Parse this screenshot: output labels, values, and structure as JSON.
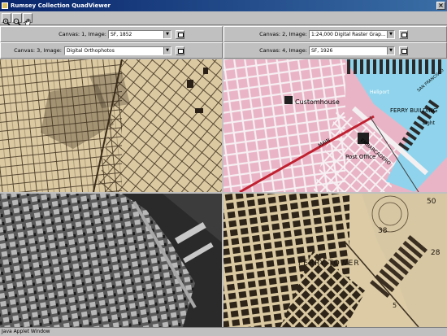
{
  "window": {
    "title": "Rumsey Collection QuadViewer",
    "close_glyph": "×"
  },
  "toolbar": {
    "tools": [
      "zoom-in-icon",
      "zoom-out-icon",
      "pan-hand-icon"
    ]
  },
  "canvases": [
    {
      "label": "Canvas: 1, Image:",
      "selected": "SF, 1852"
    },
    {
      "label": "Canvas: 2, Image:",
      "selected": "1:24,000  Digital Raster Grap..."
    },
    {
      "label": "Canvas: 3, Image:",
      "selected": "Digital Orthophotos"
    },
    {
      "label": "Canvas: 4, Image:",
      "selected": "SF, 1926"
    }
  ],
  "maps": {
    "top_right_labels": [
      "Customhouse",
      "FERRY BUILDING",
      "Light",
      "Post Office",
      "MAIN",
      "EMBARCADERO",
      "Heliport",
      "SAN FRANCISCO"
    ],
    "bottom_right_labels": [
      "FERRY TOWER",
      "50",
      "38",
      "28",
      "5"
    ]
  },
  "status": {
    "text": "Java Applet Window"
  },
  "colors": {
    "title_bar": "#08246b",
    "chrome": "#c0c0c0",
    "drg_pink": "#e9b4c6",
    "old_map": "#d8c8a0"
  }
}
